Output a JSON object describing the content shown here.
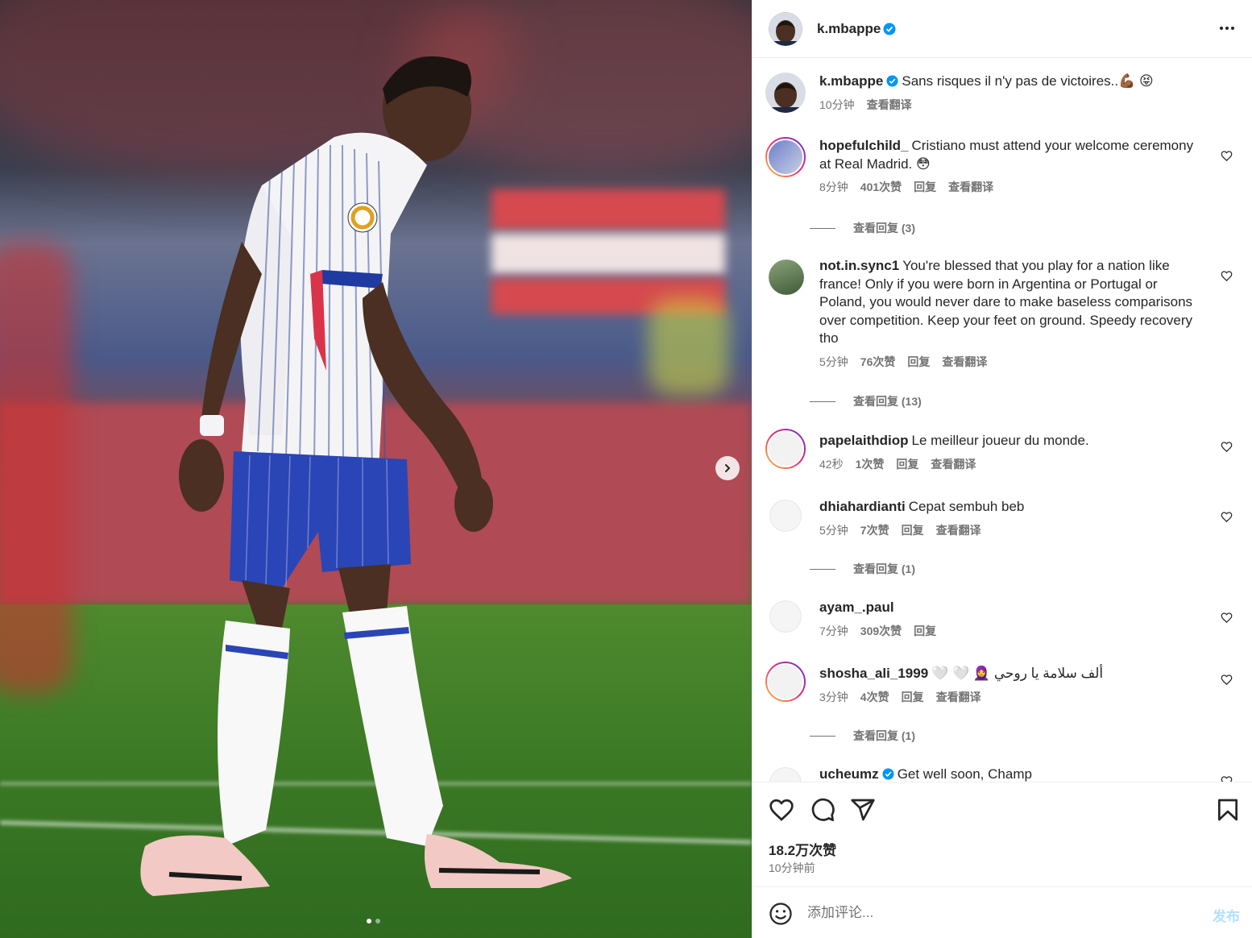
{
  "post": {
    "author": "k.mbappe",
    "verified": true,
    "caption": "Sans risques il n'y pas de victoires..💪🏾 😝",
    "caption_time": "10分钟",
    "caption_translate": "查看翻译",
    "image_alt": "Football player in white striped kit walking on pitch",
    "carousel_index": 1,
    "carousel_total": 2
  },
  "comments": [
    {
      "user": "hopefulchild_",
      "verified": false,
      "text": "Cristiano must attend your welcome ceremony at Real Madrid. 😳",
      "time": "8分钟",
      "likes": "401次赞",
      "reply": "回复",
      "translate": "查看翻译",
      "replies": "查看回复 (3)",
      "ring": true
    },
    {
      "user": "not.in.sync1",
      "verified": false,
      "text": "You're blessed that you play for a nation like france! Only if you were born in Argentina or Portugal or Poland, you would never dare to make baseless comparisons over competition. Keep your feet on ground. Speedy recovery tho",
      "time": "5分钟",
      "likes": "76次赞",
      "reply": "回复",
      "translate": "查看翻译",
      "replies": "查看回复 (13)",
      "ring": false
    },
    {
      "user": "papelaithdiop",
      "verified": false,
      "text": "Le meilleur joueur du monde.",
      "time": "42秒",
      "likes": "1次赞",
      "reply": "回复",
      "translate": "查看翻译",
      "replies": "",
      "ring": true
    },
    {
      "user": "dhiahardianti",
      "verified": false,
      "text": "Cepat sembuh beb",
      "time": "5分钟",
      "likes": "7次赞",
      "reply": "回复",
      "translate": "查看翻译",
      "replies": "查看回复 (1)",
      "ring": false
    },
    {
      "user": "ayam_.paul",
      "verified": false,
      "text": "",
      "time": "7分钟",
      "likes": "309次赞",
      "reply": "回复",
      "translate": "",
      "replies": "",
      "ring": false
    },
    {
      "user": "shosha_ali_1999",
      "verified": false,
      "text": "🤍 🤍 🧕 ألف سلامة يا روحي",
      "time": "3分钟",
      "likes": "4次赞",
      "reply": "回复",
      "translate": "查看翻译",
      "replies": "查看回复 (1)",
      "ring": true
    },
    {
      "user": "ucheumz",
      "verified": true,
      "text": "Get well soon, Champ",
      "time": "",
      "likes": "",
      "reply": "",
      "translate": "",
      "replies": "",
      "ring": false
    }
  ],
  "actions": {
    "likes_count": "18.2万次赞",
    "posted": "10分钟前"
  },
  "composer": {
    "placeholder": "添加评论...",
    "post_label": "发布"
  },
  "colors": {
    "accent": "#0095f6",
    "verified": "#0095f6",
    "post_disabled": "#b2dffc",
    "muted": "#737373"
  }
}
